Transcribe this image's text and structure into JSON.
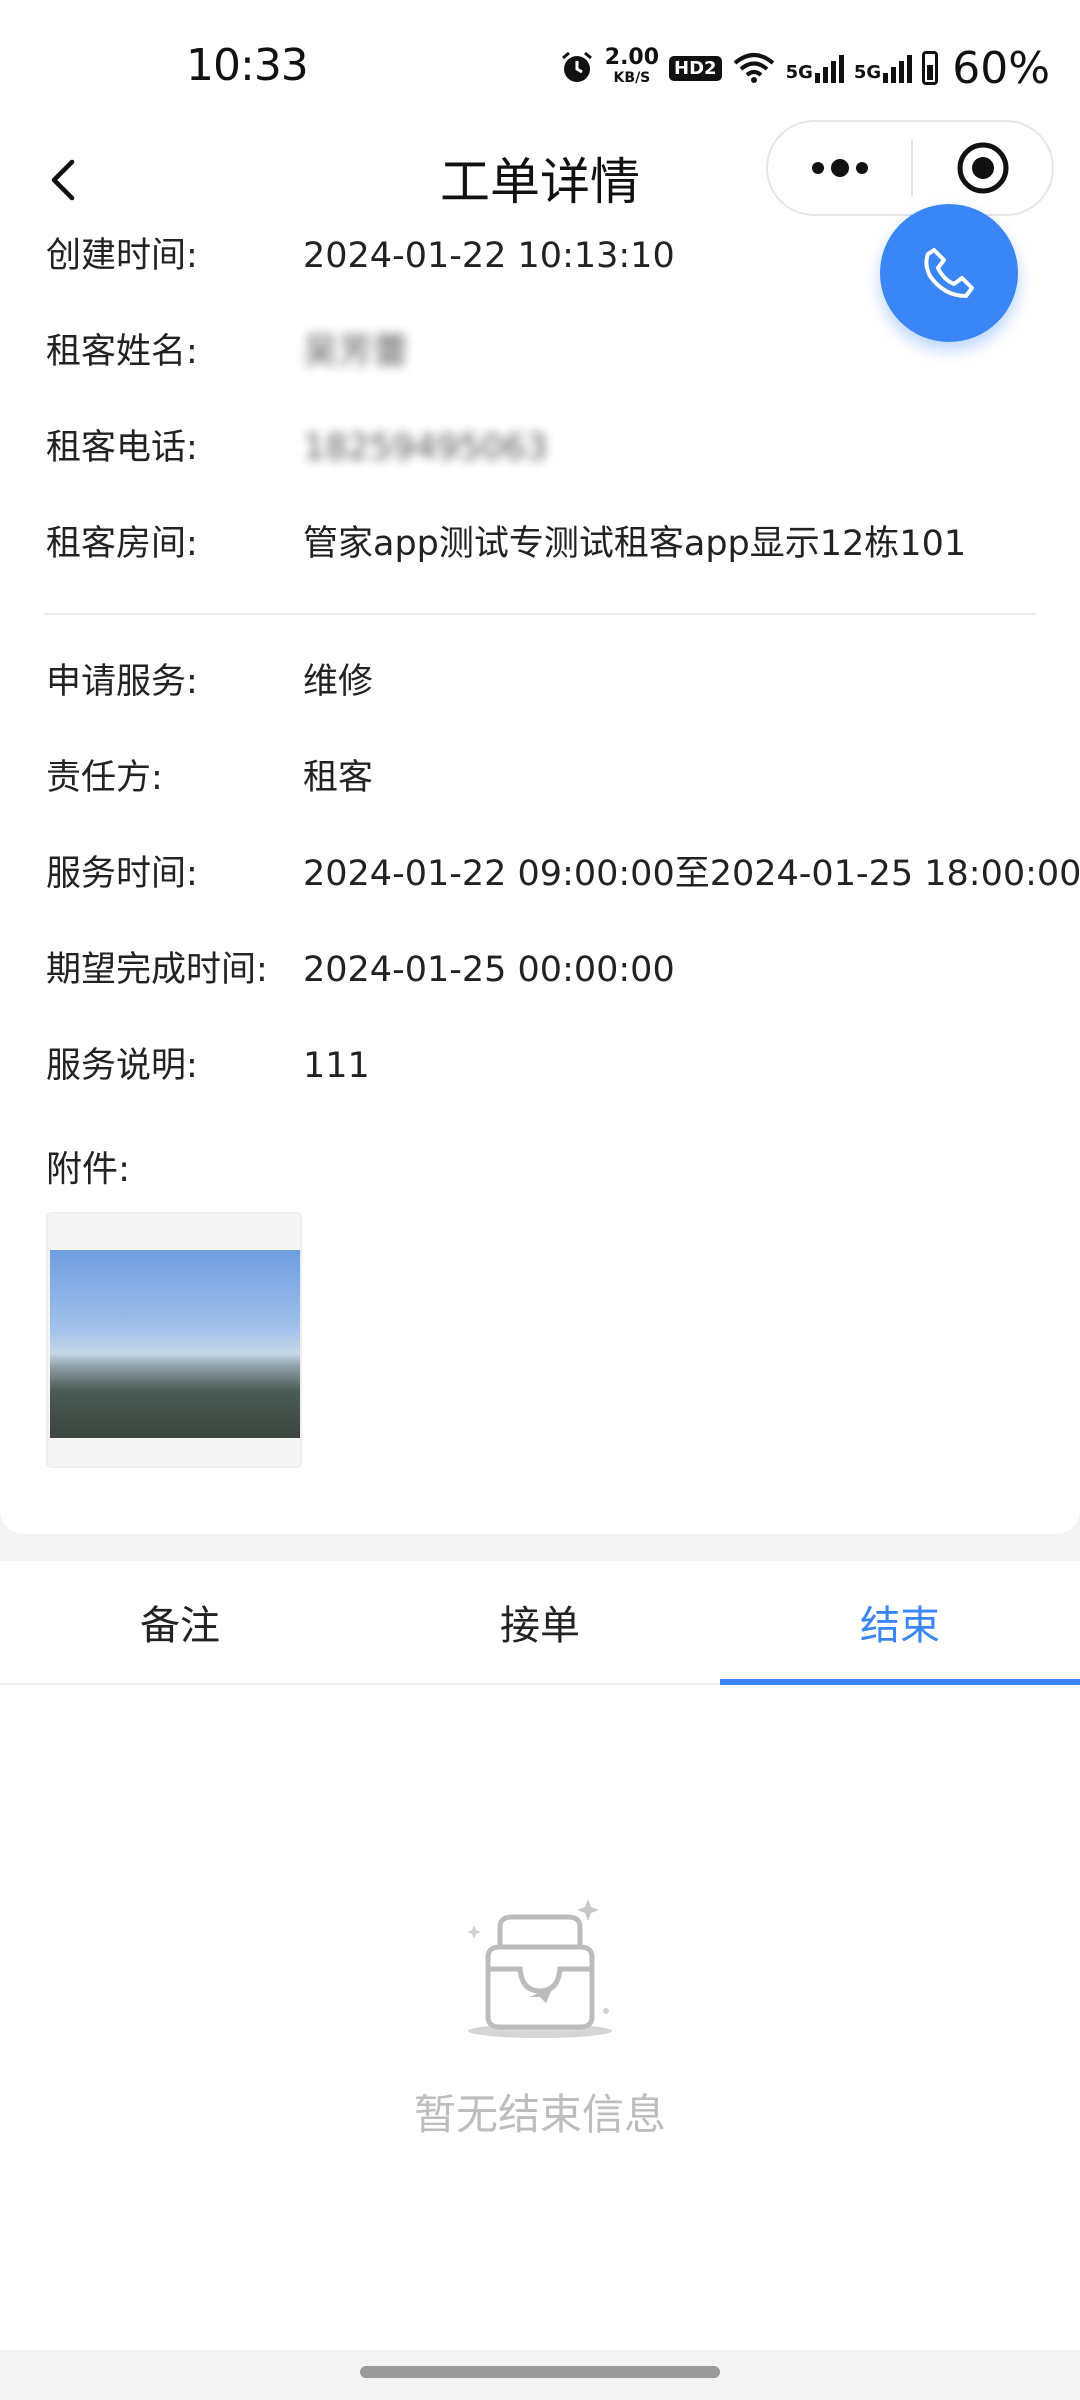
{
  "status_bar": {
    "time": "10:33",
    "net_speed_value": "2.00",
    "net_speed_unit": "KB/S",
    "hd_label": "HD2",
    "signal_label_1": "5G",
    "signal_label_2": "5G",
    "battery_percent": "60%"
  },
  "nav": {
    "title": "工单详情",
    "back_icon": "chevron-left-icon",
    "more_icon": "more-dots-icon",
    "close_icon": "target-close-icon"
  },
  "details": {
    "created_label": "创建时间:",
    "created_value": "2024-01-22 10:13:10",
    "tenant_name_label": "租客姓名:",
    "tenant_name_value": "吴芳蕾",
    "tenant_phone_label": "租客电话:",
    "tenant_phone_value": "18259495063",
    "tenant_room_label": "租客房间:",
    "tenant_room_value": "管家app测试专测试租客app显示12栋101",
    "service_label": "申请服务:",
    "service_value": "维修",
    "responsible_label": "责任方:",
    "responsible_value": "租客",
    "service_time_label": "服务时间:",
    "service_time_value": "2024-01-22 09:00:00至2024-01-25 18:00:00",
    "expected_label": "期望完成时间:",
    "expected_value": "2024-01-25 00:00:00",
    "desc_label": "服务说明:",
    "desc_value": "111",
    "attachment_label": "附件:"
  },
  "fab": {
    "icon": "phone-icon",
    "color": "#3b86f6"
  },
  "tabs": [
    {
      "label": "备注",
      "active": false
    },
    {
      "label": "接单",
      "active": false
    },
    {
      "label": "结束",
      "active": true
    }
  ],
  "empty_state": {
    "icon": "empty-inbox-icon",
    "text": "暂无结束信息"
  },
  "colors": {
    "accent": "#3b86f6",
    "muted": "#bdbdbd"
  }
}
